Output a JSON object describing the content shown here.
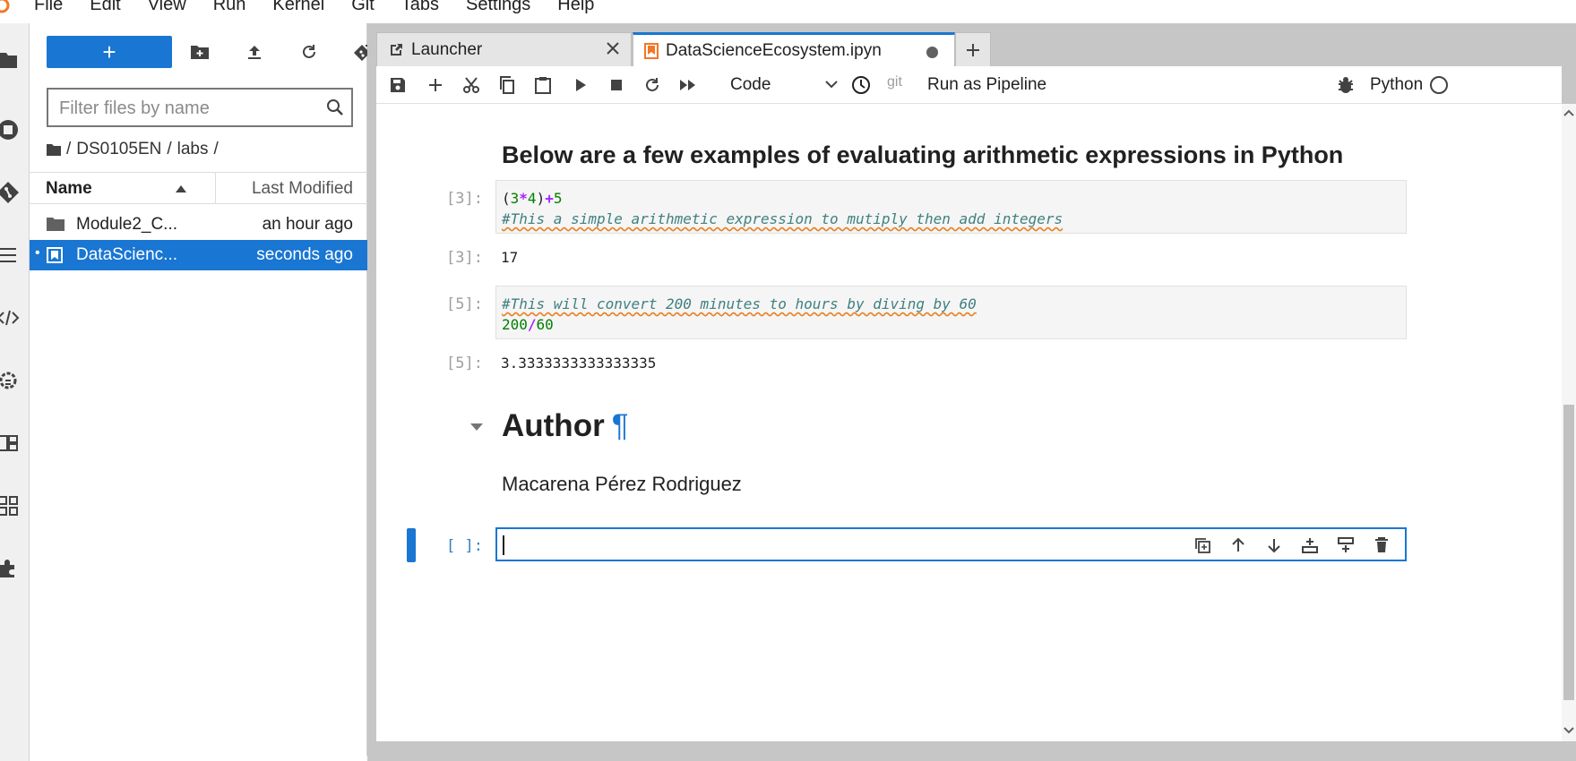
{
  "menubar": {
    "items": [
      "File",
      "Edit",
      "View",
      "Run",
      "Kernel",
      "Git",
      "Tabs",
      "Settings",
      "Help"
    ]
  },
  "filebrowser": {
    "new_label": "+",
    "filter_placeholder": "Filter files by name",
    "breadcrumb": [
      "/",
      "DS0105EN",
      "/",
      "labs",
      "/"
    ],
    "columns": {
      "name": "Name",
      "modified": "Last Modified"
    },
    "files": [
      {
        "name": "Module2_C...",
        "modified": "an hour ago",
        "type": "folder",
        "selected": false
      },
      {
        "name": "DataScienc...",
        "modified": "seconds ago",
        "type": "notebook",
        "selected": true,
        "running_dot": "•"
      }
    ]
  },
  "tabs": [
    {
      "label": "Launcher",
      "active": false
    },
    {
      "label": "DataScienceEcosystem.ipyn",
      "active": true
    }
  ],
  "toolbar": {
    "cell_type": "Code",
    "git_label": "git",
    "pipeline_label": "Run as Pipeline",
    "kernel_name": "Python"
  },
  "notebook": {
    "heading": "Below are a few examples of evaluating arithmetic expressions in Python",
    "cells": [
      {
        "prompt": "[3]:",
        "code_line1": {
          "open": "(",
          "a": "3",
          "op1": "*",
          "b": "4",
          "close": ")",
          "op2": "+",
          "c": "5"
        },
        "code_line2": "#This a simple arithmetic expression to mutiply then add integers",
        "output_prompt": "[3]:",
        "output": "17"
      },
      {
        "prompt": "[5]:",
        "code_line1": "#This will convert 200 minutes to hours by diving by 60",
        "code_line2": {
          "a": "200",
          "op": "/",
          "b": "60"
        },
        "output_prompt": "[5]:",
        "output": "3.3333333333333335"
      }
    ],
    "author_heading": "Author",
    "anchor": "¶",
    "author_name": "Macarena Pérez Rodriguez",
    "empty_prompt": "[ ]:"
  },
  "colors": {
    "accent": "#1976d2",
    "active_prompt": "#307fc1"
  }
}
